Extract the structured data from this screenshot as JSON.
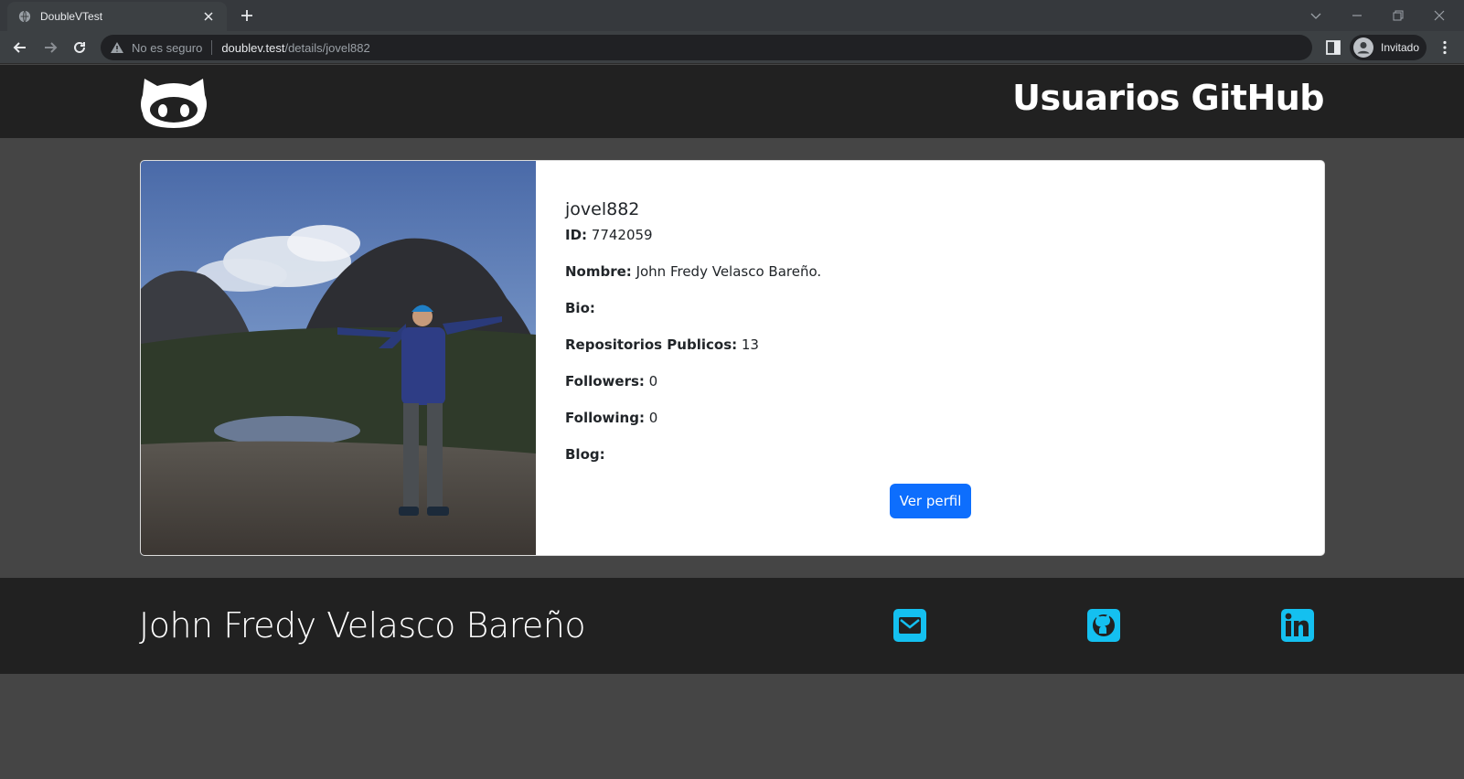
{
  "browser": {
    "tab_title": "DoubleVTest",
    "security_label": "No es seguro",
    "url_host": "doublev.test",
    "url_path": "/details/jovel882",
    "profile_label": "Invitado"
  },
  "header": {
    "title": "Usuarios GitHub"
  },
  "user": {
    "username": "jovel882",
    "id_label": "ID:",
    "id_value": " 7742059",
    "name_label": "Nombre:",
    "name_value": " John Fredy Velasco Bareño.",
    "bio_label": "Bio:",
    "bio_value": "",
    "repos_label": "Repositorios Publicos:",
    "repos_value": " 13",
    "followers_label": "Followers:",
    "followers_value": " 0",
    "following_label": "Following:",
    "following_value": " 0",
    "blog_label": "Blog:",
    "blog_value": "",
    "profile_button": "Ver perfil"
  },
  "footer": {
    "name": "John Fredy Velasco Bareño",
    "icons": [
      "mail-icon",
      "github-icon",
      "linkedin-icon"
    ]
  },
  "colors": {
    "header_bg": "#212121",
    "page_bg": "#454545",
    "button": "#0d6efd",
    "social_icon": "#14c0f0"
  }
}
